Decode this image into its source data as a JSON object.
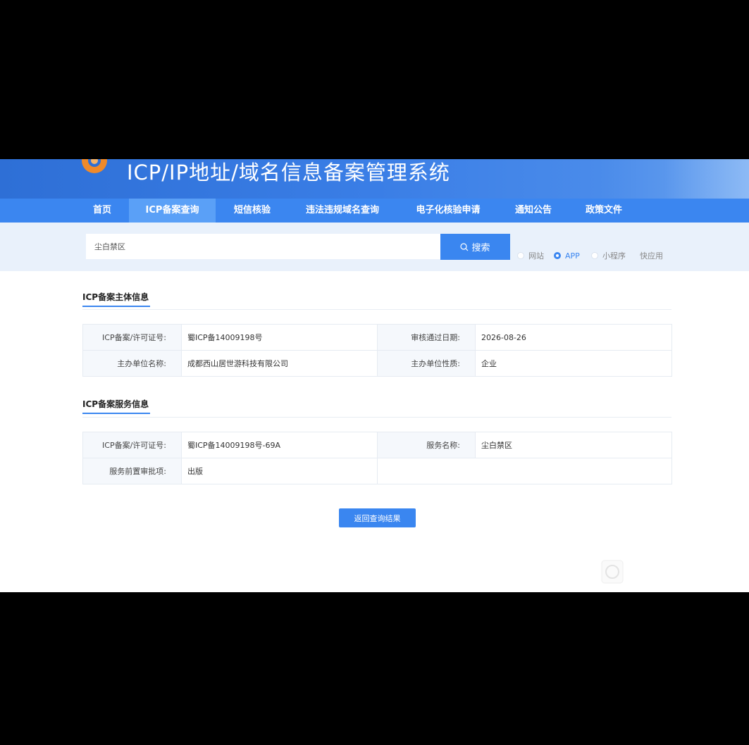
{
  "header": {
    "site_title": "ICP/IP地址/域名信息备案管理系统"
  },
  "nav": {
    "items": [
      {
        "label": "首页"
      },
      {
        "label": "ICP备案查询"
      },
      {
        "label": "短信核验"
      },
      {
        "label": "违法违规域名查询"
      },
      {
        "label": "电子化核验申请"
      },
      {
        "label": "通知公告"
      },
      {
        "label": "政策文件"
      }
    ],
    "active_index": 1
  },
  "search": {
    "value": "尘白禁区",
    "button_label": "搜索",
    "types": [
      {
        "label": "网站",
        "checked": false
      },
      {
        "label": "APP",
        "checked": true
      },
      {
        "label": "小程序",
        "checked": false
      },
      {
        "label": "快应用",
        "checked": false
      }
    ]
  },
  "subject_section": {
    "title": "ICP备案主体信息",
    "rows": [
      [
        "ICP备案/许可证号:",
        "蜀ICP备14009198号",
        "审核通过日期:",
        "2026-08-26"
      ],
      [
        "主办单位名称:",
        "成都西山居世游科技有限公司",
        "主办单位性质:",
        "企业"
      ]
    ]
  },
  "service_section": {
    "title": "ICP备案服务信息",
    "rows": [
      [
        "ICP备案/许可证号:",
        "蜀ICP备14009198号-69A",
        "服务名称:",
        "尘白禁区"
      ],
      [
        "服务前置审批项:",
        "出版"
      ]
    ]
  },
  "back_button_label": "返回查询结果",
  "colors": {
    "primary": "#3a86f0",
    "nav_bg": "#3b86f0",
    "nav_active": "#5aa0f7",
    "search_strip": "#e9f1fb"
  }
}
